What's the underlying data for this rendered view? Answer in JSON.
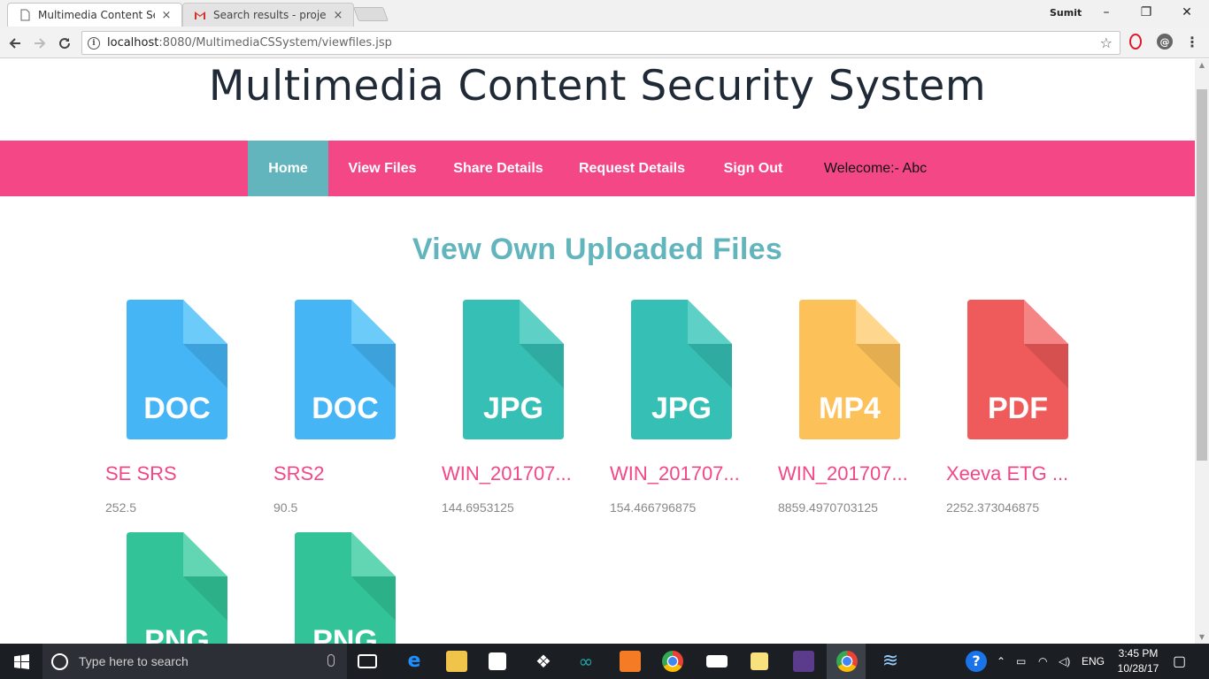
{
  "browser": {
    "tabs": [
      {
        "title": "Multimedia Content Secu",
        "close": "×"
      },
      {
        "title": "Search results - projectw",
        "close": "×"
      }
    ],
    "profile": "Sumit",
    "window_controls": {
      "minimize": "–",
      "maximize": "❐",
      "close": "✕"
    },
    "url_host": "localhost",
    "url_path": ":8080/MultimediaCSSystem/viewfiles.jsp"
  },
  "site": {
    "title": "Multimedia Content Security System",
    "nav": [
      {
        "label": "Home",
        "active": true
      },
      {
        "label": "View Files",
        "active": false
      },
      {
        "label": "Share Details",
        "active": false
      },
      {
        "label": "Request Details",
        "active": false
      },
      {
        "label": "Sign Out",
        "active": false
      }
    ],
    "welcome": "Welecome:- Abc",
    "section_title": "View Own Uploaded Files"
  },
  "files": [
    {
      "type": "DOC",
      "name": "SE SRS",
      "size": "252.5",
      "color": "#45b5f5",
      "fold": "#6dcbf9"
    },
    {
      "type": "DOC",
      "name": "SRS2",
      "size": "90.5",
      "color": "#45b5f5",
      "fold": "#6dcbf9"
    },
    {
      "type": "JPG",
      "name": "WIN_201707...",
      "size": "144.6953125",
      "color": "#36bfb4",
      "fold": "#5fd0c6"
    },
    {
      "type": "JPG",
      "name": "WIN_201707...",
      "size": "154.466796875",
      "color": "#36bfb4",
      "fold": "#5fd0c6"
    },
    {
      "type": "MP4",
      "name": "WIN_201707...",
      "size": "8859.4970703125",
      "color": "#fdc15a",
      "fold": "#fed68e"
    },
    {
      "type": "PDF",
      "name": "Xeeva ETG ...",
      "size": "2252.373046875",
      "color": "#ef5a5a",
      "fold": "#f58484"
    },
    {
      "type": "PNG",
      "name": "",
      "size": "",
      "color": "#32c498",
      "fold": "#62d6b3"
    },
    {
      "type": "PNG",
      "name": "",
      "size": "",
      "color": "#32c498",
      "fold": "#62d6b3"
    }
  ],
  "taskbar": {
    "search_placeholder": "Type here to search",
    "language": "ENG",
    "time": "3:45 PM",
    "date": "10/28/17"
  }
}
